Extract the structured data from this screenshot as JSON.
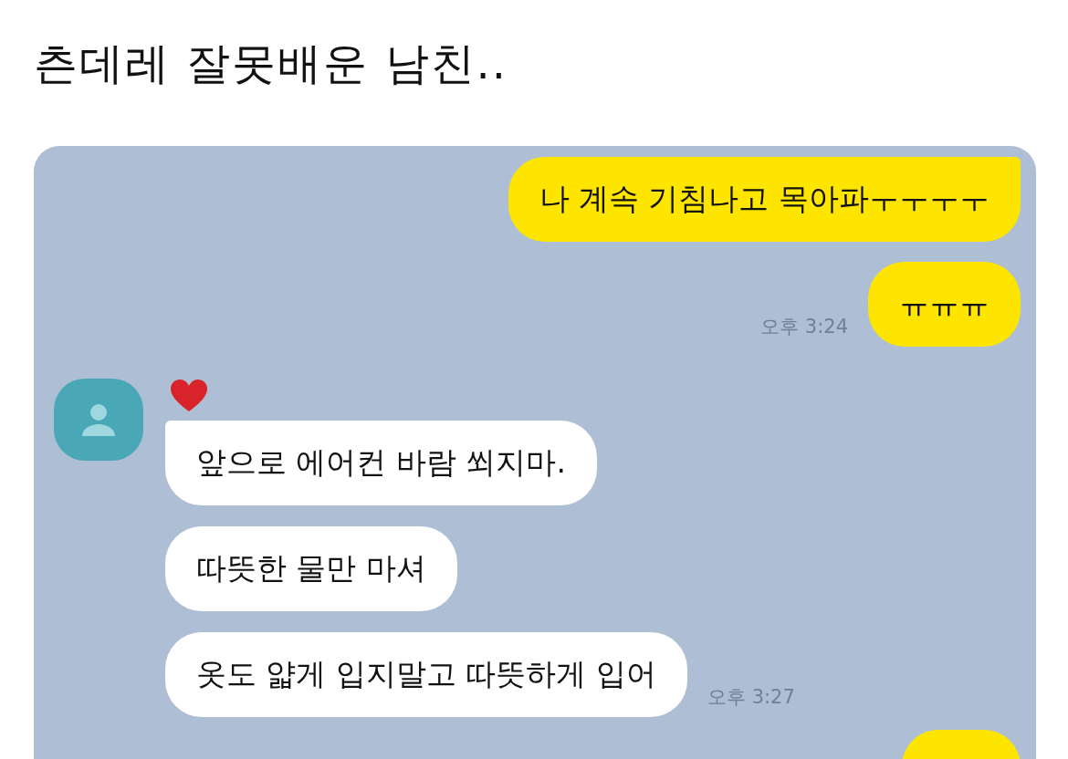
{
  "post": {
    "title": "츤데레 잘못배운 남친.."
  },
  "chat": {
    "groups": [
      {
        "kind": "sent",
        "time": "오후 3:24",
        "messages": [
          "나 계속 기침나고 목아파ㅜㅜㅜㅜ",
          "ㅠㅠㅠ"
        ]
      },
      {
        "kind": "received",
        "hearted": true,
        "time": "오후 3:27",
        "messages": [
          "앞으로 에어컨 바람 쐬지마.",
          "따뜻한 물만 마셔",
          "옷도 얇게 입지말고 따뜻하게 입어"
        ]
      }
    ]
  }
}
